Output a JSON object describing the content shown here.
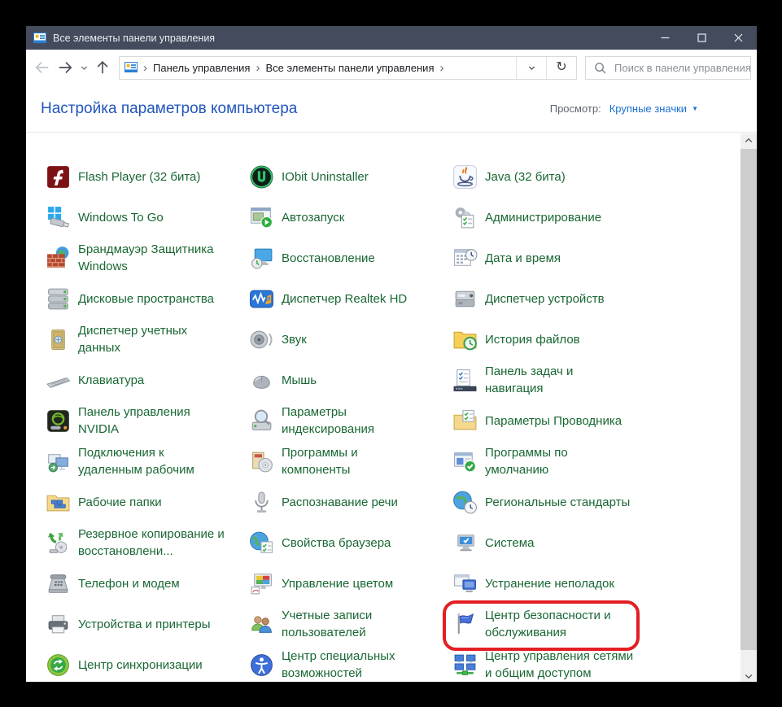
{
  "window": {
    "title": "Все элементы панели управления"
  },
  "toolbar": {
    "breadcrumb": {
      "items": [
        "Панель управления",
        "Все элементы панели управления"
      ]
    },
    "search": {
      "placeholder": "Поиск в панели управления"
    }
  },
  "header": {
    "title": "Настройка параметров компьютера",
    "view_label": "Просмотр:",
    "view_value": "Крупные значки"
  },
  "colors": {
    "titlebar": "#434b5c",
    "heading_blue": "#2155bd",
    "link_blue": "#1a6fd4",
    "item_green": "#196733",
    "highlight_red": "#e31e24"
  },
  "columns": [
    {
      "items": [
        {
          "label": "Flash Player (32 бита)",
          "icon": "flash-player-icon"
        },
        {
          "label": "Windows To Go",
          "icon": "windows-to-go-icon"
        },
        {
          "label": "Брандмауэр Защитника\nWindows",
          "icon": "firewall-icon"
        },
        {
          "label": "Дисковые пространства",
          "icon": "storage-spaces-icon"
        },
        {
          "label": "Диспетчер учетных\nданных",
          "icon": "credential-manager-icon"
        },
        {
          "label": "Клавиатура",
          "icon": "keyboard-icon"
        },
        {
          "label": "Панель управления\nNVIDIA",
          "icon": "nvidia-icon"
        },
        {
          "label": "Подключения к\nудаленным рабочим",
          "icon": "remote-desktop-icon"
        },
        {
          "label": "Рабочие папки",
          "icon": "work-folders-icon"
        },
        {
          "label": "Резервное копирование и\nвосстановлени...",
          "icon": "backup-restore-icon"
        },
        {
          "label": "Телефон и модем",
          "icon": "phone-modem-icon"
        },
        {
          "label": "Устройства и принтеры",
          "icon": "devices-printers-icon"
        },
        {
          "label": "Центр синхронизации",
          "icon": "sync-center-icon"
        }
      ]
    },
    {
      "items": [
        {
          "label": "IObit Uninstaller",
          "icon": "iobit-uninstaller-icon"
        },
        {
          "label": "Автозапуск",
          "icon": "autoplay-icon"
        },
        {
          "label": "Восстановление",
          "icon": "recovery-icon"
        },
        {
          "label": "Диспетчер Realtek HD",
          "icon": "realtek-audio-icon"
        },
        {
          "label": "Звук",
          "icon": "sound-icon"
        },
        {
          "label": "Мышь",
          "icon": "mouse-icon"
        },
        {
          "label": "Параметры\nиндексирования",
          "icon": "indexing-options-icon"
        },
        {
          "label": "Программы и\nкомпоненты",
          "icon": "programs-features-icon"
        },
        {
          "label": "Распознавание речи",
          "icon": "speech-recognition-icon"
        },
        {
          "label": "Свойства браузера",
          "icon": "internet-options-icon"
        },
        {
          "label": "Управление цветом",
          "icon": "color-management-icon"
        },
        {
          "label": "Учетные записи\nпользователей",
          "icon": "user-accounts-icon"
        },
        {
          "label": "Центр специальных\nвозможностей",
          "icon": "ease-of-access-icon"
        }
      ]
    },
    {
      "items": [
        {
          "label": "Java (32 бита)",
          "icon": "java-icon"
        },
        {
          "label": "Администрирование",
          "icon": "administrative-tools-icon"
        },
        {
          "label": "Дата и время",
          "icon": "date-time-icon"
        },
        {
          "label": "Диспетчер устройств",
          "icon": "device-manager-icon"
        },
        {
          "label": "История файлов",
          "icon": "file-history-icon"
        },
        {
          "label": "Панель задач и\nнавигация",
          "icon": "taskbar-navigation-icon"
        },
        {
          "label": "Параметры Проводника",
          "icon": "explorer-options-icon"
        },
        {
          "label": "Программы по\nумолчанию",
          "icon": "default-programs-icon"
        },
        {
          "label": "Региональные стандарты",
          "icon": "region-icon"
        },
        {
          "label": "Система",
          "icon": "system-icon"
        },
        {
          "label": "Устранение неполадок",
          "icon": "troubleshooting-icon"
        },
        {
          "label": "Центр безопасности и\nобслуживания",
          "icon": "security-maintenance-icon",
          "highlighted": true
        },
        {
          "label": "Центр управления сетями\nи общим доступом",
          "icon": "network-sharing-icon"
        }
      ]
    }
  ]
}
